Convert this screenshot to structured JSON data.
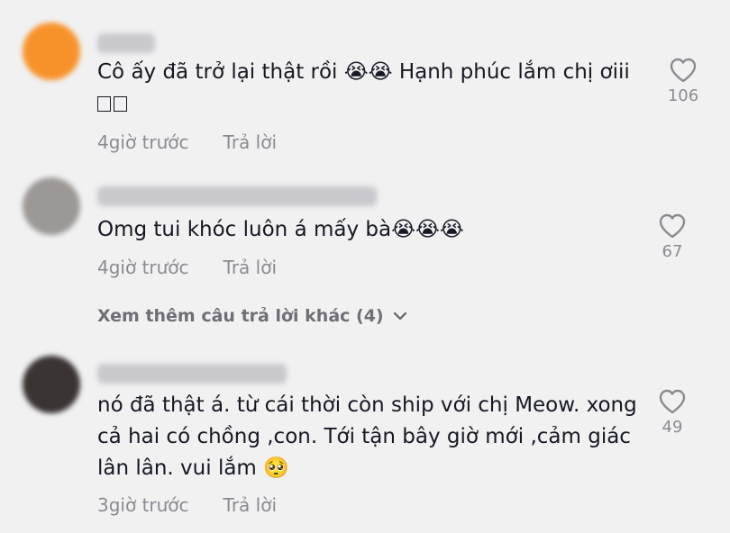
{
  "comments": [
    {
      "text_line1": "Cô ấy đã trở lại thật rồi 😭😭 Hạnh phúc lắm chị ơiii",
      "time": "4giờ trước",
      "reply_label": "Trả lời",
      "likes": "106",
      "avatar_color": "#f7922a"
    },
    {
      "text_line1": "Omg tui khóc luôn á mấy bà😭😭😭",
      "time": "4giờ trước",
      "reply_label": "Trả lời",
      "likes": "67",
      "avatar_color": "#9b9896"
    },
    {
      "text_line1": "nó đã thật á. từ cái thời còn ship với chị Meow. xong",
      "text_line2": "cả hai có chồng ,con. Tới tận bây giờ mới ,cảm giác",
      "text_line3": "lân lân. vui lắm 🥺",
      "time": "3giờ trước",
      "reply_label": "Trả lời",
      "likes": "49",
      "avatar_color": "#3a3433"
    }
  ],
  "more_replies_label": "Xem thêm câu trả lời khác (4)"
}
